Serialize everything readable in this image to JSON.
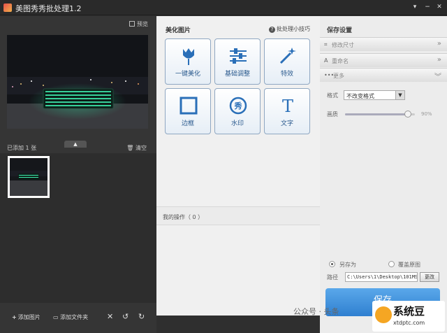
{
  "window": {
    "title": "美图秀秀批处理1.2",
    "controls": [
      "menu-icon",
      "minimize-icon",
      "close-icon"
    ]
  },
  "left_panel": {
    "preview_label": "预览",
    "added_count_label": "已添加 1 张",
    "clear_label": "清空",
    "tools": {
      "add_image": "添加图片",
      "add_folder": "添加文件夹"
    }
  },
  "middle_panel": {
    "title": "美化图片",
    "tips_label": "批处理小技巧",
    "effects": [
      {
        "label": "一键美化",
        "icon": "tulip-icon"
      },
      {
        "label": "基础调整",
        "icon": "sliders-icon"
      },
      {
        "label": "特效",
        "icon": "magic-wand-icon"
      },
      {
        "label": "边框",
        "icon": "frame-icon"
      },
      {
        "label": "水印",
        "icon": "watermark-icon"
      },
      {
        "label": "文字",
        "icon": "text-icon"
      }
    ],
    "ops_label": "我的操作（ 0 ）"
  },
  "right_panel": {
    "title": "保存设置",
    "sections": {
      "resize": "修改尺寸",
      "rename": "重命名",
      "more": "更多"
    },
    "format_label": "格式",
    "format_value": "不改变格式",
    "quality_label": "画质",
    "quality_value_text": "90%",
    "quality_value": 0.9,
    "save_as_label": "另存为",
    "overwrite_label": "覆盖原图",
    "save_mode": "另存为",
    "path_label": "路径",
    "path_value": "C:\\Users\\1\\Desktop\\101MSDC",
    "change_label": "更改",
    "save_button_label": "保存"
  },
  "watermark": {
    "text": "公众号 · 头条",
    "badge_title": "系统豆",
    "badge_url": "xtdptc.com"
  },
  "colors": {
    "accent": "#2f7fd0",
    "effect_label": "#2a5a8e",
    "dark_bg": "#353535"
  }
}
